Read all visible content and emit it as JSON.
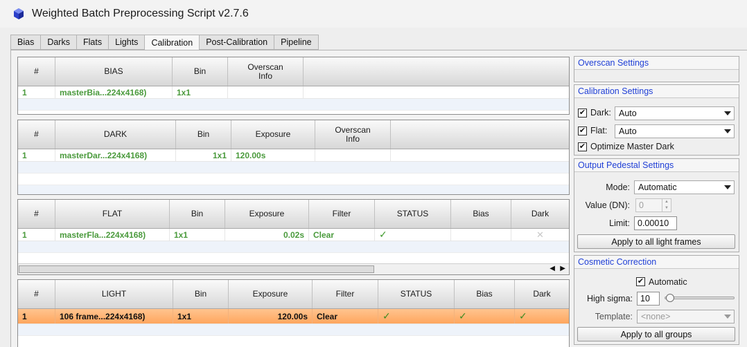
{
  "window": {
    "title": "Weighted Batch Preprocessing Script v2.7.6"
  },
  "tabs": [
    "Bias",
    "Darks",
    "Flats",
    "Lights",
    "Calibration",
    "Post-Calibration",
    "Pipeline"
  ],
  "active_tab": "Calibration",
  "bias_table": {
    "headers": [
      "#",
      "BIAS",
      "Bin",
      "Overscan\nInfo"
    ],
    "rows": [
      {
        "num": "1",
        "name": "masterBia...224x4168)",
        "bin": "1x1",
        "overscan": ""
      }
    ]
  },
  "dark_table": {
    "headers": [
      "#",
      "DARK",
      "Bin",
      "Exposure",
      "Overscan\nInfo"
    ],
    "rows": [
      {
        "num": "1",
        "name": "masterDar...224x4168)",
        "bin": "1x1",
        "exposure": "120.00s",
        "overscan": ""
      }
    ]
  },
  "flat_table": {
    "headers": [
      "#",
      "FLAT",
      "Bin",
      "Exposure",
      "Filter",
      "STATUS",
      "Bias",
      "Dark"
    ],
    "rows": [
      {
        "num": "1",
        "name": "masterFla...224x4168)",
        "bin": "1x1",
        "exposure": "0.02s",
        "filter": "Clear",
        "status": "ok",
        "bias": "",
        "dark": "excluded"
      }
    ]
  },
  "light_table": {
    "headers": [
      "#",
      "LIGHT",
      "Bin",
      "Exposure",
      "Filter",
      "STATUS",
      "Bias",
      "Dark"
    ],
    "rows": [
      {
        "num": "1",
        "name": "106 frame...224x4168)",
        "bin": "1x1",
        "exposure": "120.00s",
        "filter": "Clear",
        "status": "ok",
        "bias": "ok",
        "dark": "ok",
        "selected": true
      }
    ]
  },
  "icons": {
    "check": "✔",
    "cross": "✕",
    "checkmark_glyph": "✓"
  },
  "overscan_settings": {
    "title": "Overscan Settings"
  },
  "calibration_settings": {
    "title": "Calibration Settings",
    "dark_label": "Dark:",
    "dark_checked": true,
    "dark_value": "Auto",
    "flat_label": "Flat:",
    "flat_checked": true,
    "flat_value": "Auto",
    "optimize_label": "Optimize Master Dark",
    "optimize_checked": true
  },
  "output_pedestal": {
    "title": "Output Pedestal Settings",
    "mode_label": "Mode:",
    "mode_value": "Automatic",
    "value_label": "Value (DN):",
    "value_value": "0",
    "limit_label": "Limit:",
    "limit_value": "0.00010",
    "apply_button": "Apply to all light frames"
  },
  "cosmetic_correction": {
    "title": "Cosmetic Correction",
    "automatic_label": "Automatic",
    "automatic_checked": true,
    "high_sigma_label": "High sigma:",
    "high_sigma_value": "10",
    "high_sigma_slider_fraction": 0.08,
    "template_label": "Template:",
    "template_value": "<none>",
    "apply_button": "Apply to all groups"
  },
  "colors": {
    "accent_title": "#1f3fd6",
    "ok_green": "#4a9a3c",
    "selected_row": "#ffb373"
  }
}
